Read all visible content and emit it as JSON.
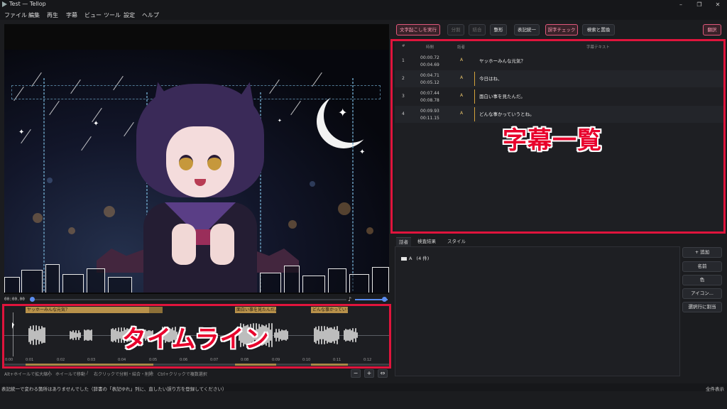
{
  "window": {
    "title": "Test — Tellop",
    "minimize": "–",
    "maximize": "❐",
    "close": "✕"
  },
  "menu": [
    "ファイル",
    "編集",
    "再生",
    "字幕",
    "ビュー",
    "ツール",
    "設定",
    "ヘルプ"
  ],
  "player": {
    "timecode": "00:00.00",
    "volume": 1.0
  },
  "timeline": {
    "subtitles": [
      "ヤッホーみんな元気？",
      "面白い事を見たんだ。",
      "どんな事かっていうとね。"
    ],
    "ticks": [
      "0:00",
      "0:01",
      "0:02",
      "0:03",
      "0:04",
      "0:05",
      "0:06",
      "0:07",
      "0:08",
      "0:09",
      "0:10",
      "0:11",
      "0:12"
    ],
    "annotation_label": "タイムライン"
  },
  "hints": [
    "Alt+ホイールで拡大縮小",
    "ホイールで移動",
    "右クリックで分割・結合・削除",
    "Ctrl+クリックで複数選択"
  ],
  "zoom_buttons": {
    "zoom_out": "−",
    "zoom_in": "+",
    "fit": "⇔"
  },
  "toolbar": {
    "transcribe": "文字起こしを実行",
    "split": "分割",
    "merge": "結合",
    "format": "整形",
    "notation": "表記統一",
    "typo_check": "誤字チェック",
    "search_replace": "検索と置換",
    "translate": "翻訳"
  },
  "table": {
    "headers": {
      "num": "#",
      "time": "時間",
      "speaker": "話者",
      "text": "字幕テキスト"
    },
    "rows": [
      {
        "num": "1",
        "start": "00:00.72",
        "end": "00:04.69",
        "speaker": "A",
        "text": "ヤッホーみんな元気？"
      },
      {
        "num": "2",
        "start": "00:04.71",
        "end": "00:05.12",
        "speaker": "A",
        "text": "今日はね、"
      },
      {
        "num": "3",
        "start": "00:07.44",
        "end": "00:08.78",
        "speaker": "A",
        "text": "面白い事を見たんだ。"
      },
      {
        "num": "4",
        "start": "00:09.93",
        "end": "00:11.15",
        "speaker": "A",
        "text": "どんな事かっていうとね。"
      }
    ],
    "annotation_label": "字幕一覧"
  },
  "tabs": [
    "話者",
    "検査結果",
    "スタイル"
  ],
  "speakers": [
    {
      "name": "A",
      "count": "(4 件)"
    }
  ],
  "speaker_buttons": [
    "+ 追加",
    "名前",
    "色",
    "アイコン...",
    "選択行に割当"
  ],
  "status": {
    "message": "表記統一で変わる箇所はありませんでした（辞書の「表記ゆれ」列に、直したい誤り方を登録してください）",
    "right": "全件表示"
  },
  "colors": {
    "accent": "#5b8df0",
    "highlight": "#e0143c",
    "subtitle_block": "#b8914a",
    "speaker_A": "#d4a33c"
  }
}
